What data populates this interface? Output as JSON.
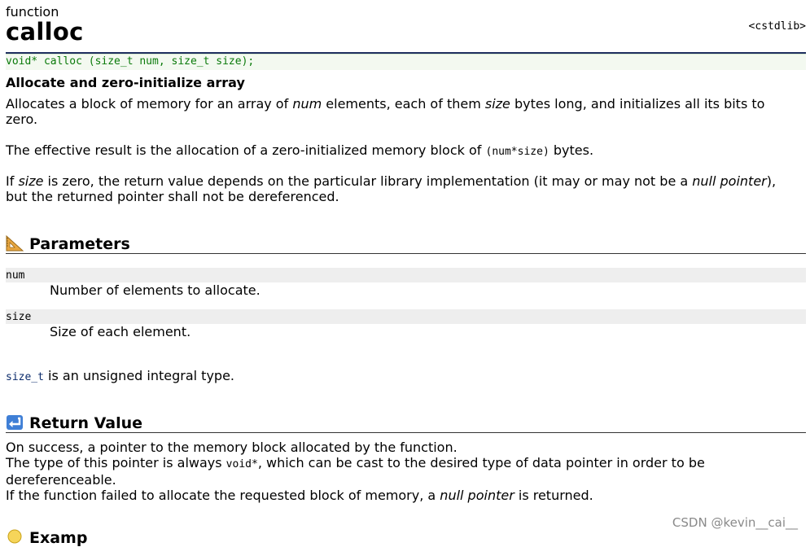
{
  "kind": "function",
  "title": "calloc",
  "header": "<cstdlib>",
  "prototype": "void* calloc (size_t num, size_t size);",
  "summary": "Allocate and zero-initialize array",
  "description": {
    "p1_a": "Allocates a block of memory for an array of ",
    "p1_num": "num",
    "p1_b": " elements, each of them ",
    "p1_size": "size",
    "p1_c": " bytes long, and initializes all its bits to",
    "p1_d": "zero.",
    "p2_a": "The effective result is the allocation of a zero-initialized memory block of ",
    "p2_code": "(num*size)",
    "p2_b": " bytes.",
    "p3_a": "If ",
    "p3_size": "size",
    "p3_b": " is zero, the return value depends on the particular library implementation (it may or may not be a ",
    "p3_null": "null pointer",
    "p3_c": "),",
    "p3_d": "but the returned pointer shall not be dereferenced."
  },
  "parameters": {
    "heading": "Parameters",
    "items": [
      {
        "name": "num",
        "desc": "Number of elements to allocate."
      },
      {
        "name": "size",
        "desc": "Size of each element."
      }
    ],
    "note_code": "size_t",
    "note_text": " is an unsigned integral type."
  },
  "return_value": {
    "heading": "Return Value",
    "l1": "On success, a pointer to the memory block allocated by the function.",
    "l2_a": "The type of this pointer is always ",
    "l2_code": "void*",
    "l2_b": ", which can be cast to the desired type of data pointer in order to be",
    "l3": "dereferenceable.",
    "l4_a": "If the function failed to allocate the requested block of memory, a ",
    "l4_null": "null pointer",
    "l4_b": " is returned."
  },
  "next_section_partial": "Examp",
  "watermark": "CSDN @kevin__cai__",
  "icons": {
    "parameters": "set-square-icon",
    "return_value": "return-arrow-icon",
    "next": "lightbulb-icon"
  },
  "colors": {
    "prototype_text": "#0a7a0a",
    "title_rule": "#1f2f5f"
  }
}
